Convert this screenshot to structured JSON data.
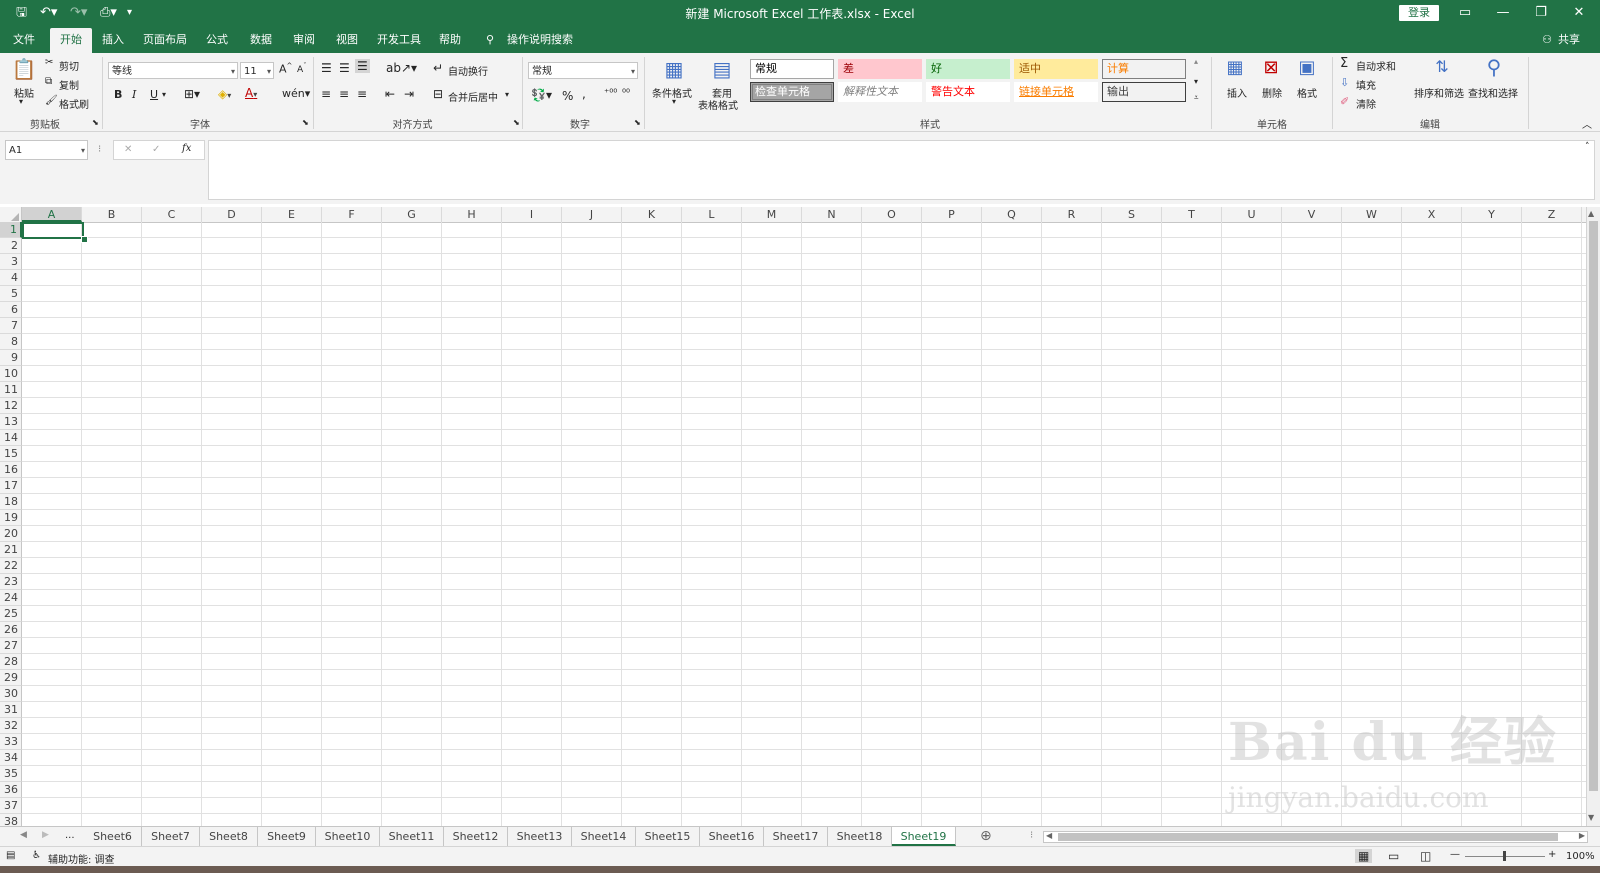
{
  "window": {
    "title": "新建 Microsoft Excel 工作表.xlsx  -  Excel",
    "login_label": "登录",
    "minimize": "—",
    "restore": "❐",
    "close": "✕"
  },
  "menu": {
    "tabs": [
      "文件",
      "开始",
      "插入",
      "页面布局",
      "公式",
      "数据",
      "审阅",
      "视图",
      "开发工具",
      "帮助"
    ],
    "active": "开始",
    "tell_me": "操作说明搜索",
    "share": "共享"
  },
  "ribbon": {
    "clipboard": {
      "paste": "粘贴",
      "cut": "剪切",
      "copy": "复制",
      "format_painter": "格式刷",
      "label": "剪贴板"
    },
    "font": {
      "name": "等线",
      "size": "11",
      "bold": "B",
      "italic": "I",
      "underline": "U",
      "label": "字体"
    },
    "alignment": {
      "wrap": "自动换行",
      "merge": "合并后居中",
      "label": "对齐方式"
    },
    "number": {
      "format": "常规",
      "percent": "%",
      "comma": ",",
      "label": "数字"
    },
    "styles": {
      "conditional": "条件格式",
      "table_format_1": "套用",
      "table_format_2": "表格格式",
      "cells": [
        {
          "text": "常规",
          "bg": "#ffffff",
          "fg": "#000000",
          "border": "#a6a6a6"
        },
        {
          "text": "差",
          "bg": "#ffc7ce",
          "fg": "#9c0006",
          "border": "#ffc7ce"
        },
        {
          "text": "好",
          "bg": "#c6efce",
          "fg": "#006100",
          "border": "#c6efce"
        },
        {
          "text": "适中",
          "bg": "#ffeb9c",
          "fg": "#9c5700",
          "border": "#ffeb9c"
        },
        {
          "text": "计算",
          "bg": "#f2f2f2",
          "fg": "#fa7d00",
          "border": "#7f7f7f"
        },
        {
          "text": "检查单元格",
          "bg": "#a5a5a5",
          "fg": "#ffffff",
          "border": "#3f3f3f"
        },
        {
          "text": "解释性文本",
          "bg": "#ffffff",
          "fg": "#7f7f7f",
          "border": "#ffffff"
        },
        {
          "text": "警告文本",
          "bg": "#ffffff",
          "fg": "#ff0000",
          "border": "#ffffff"
        },
        {
          "text": "链接单元格",
          "bg": "#ffffff",
          "fg": "#fa7d00",
          "border": "#ffffff"
        },
        {
          "text": "输出",
          "bg": "#f2f2f2",
          "fg": "#3f3f3f",
          "border": "#3f3f3f"
        }
      ],
      "label": "样式"
    },
    "cells": {
      "insert": "插入",
      "delete": "删除",
      "format": "格式",
      "label": "单元格"
    },
    "editing": {
      "autosum": "自动求和",
      "fill": "填充",
      "clear": "清除",
      "sort": "排序和筛选",
      "find": "查找和选择",
      "label": "编辑"
    }
  },
  "formula_bar": {
    "name_box": "A1",
    "cancel": "✕",
    "enter": "✓",
    "fx": "fx",
    "value": ""
  },
  "grid": {
    "columns": [
      "A",
      "B",
      "C",
      "D",
      "E",
      "F",
      "G",
      "H",
      "I",
      "J",
      "K",
      "L",
      "M",
      "N",
      "O",
      "P",
      "Q",
      "R",
      "S",
      "T",
      "U",
      "V",
      "W",
      "X",
      "Y",
      "Z"
    ],
    "rows": [
      "1",
      "2",
      "3",
      "4",
      "5",
      "6",
      "7",
      "8",
      "9",
      "10",
      "11",
      "12",
      "13",
      "14",
      "15",
      "16",
      "17",
      "18",
      "19",
      "20",
      "21",
      "22",
      "23",
      "24",
      "25",
      "26",
      "27",
      "28",
      "29",
      "30",
      "31",
      "32",
      "33",
      "34",
      "35",
      "36",
      "37",
      "38"
    ],
    "selected": "A1"
  },
  "sheets": {
    "tabs": [
      "Sheet6",
      "Sheet7",
      "Sheet8",
      "Sheet9",
      "Sheet10",
      "Sheet11",
      "Sheet12",
      "Sheet13",
      "Sheet14",
      "Sheet15",
      "Sheet16",
      "Sheet17",
      "Sheet18",
      "Sheet19"
    ],
    "active": "Sheet19",
    "ellipsis": "..."
  },
  "status": {
    "accessibility": "辅助功能: 调查",
    "zoom": "100%"
  },
  "watermark": {
    "brand": "Bai du 经验",
    "url": "jingyan.baidu.com"
  },
  "colors": {
    "excel_green": "#217346",
    "ribbon_bg": "#f3f3f3",
    "grid_line": "#e1e1e1"
  }
}
